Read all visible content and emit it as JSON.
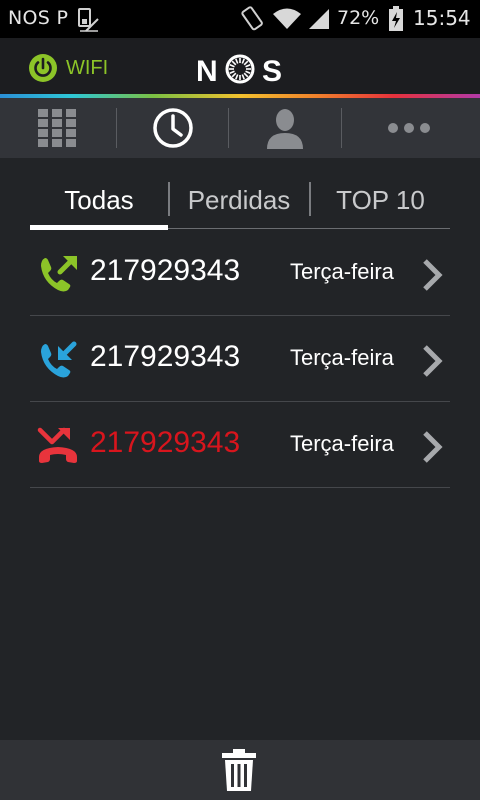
{
  "status_bar": {
    "carrier": "NOS P",
    "battery_percent": "72%",
    "time": "15:54"
  },
  "header": {
    "wifi_label": "WIFI",
    "wifi_color": "#8cc428",
    "logo_text": "NOS"
  },
  "nav": {
    "items": [
      {
        "icon": "dialpad-icon",
        "active": false
      },
      {
        "icon": "clock-icon",
        "active": true
      },
      {
        "icon": "contact-icon",
        "active": false
      },
      {
        "icon": "more-icon",
        "active": false
      }
    ]
  },
  "tabs": [
    {
      "label": "Todas",
      "active": true
    },
    {
      "label": "Perdidas",
      "active": false
    },
    {
      "label": "TOP 10",
      "active": false
    }
  ],
  "calls": [
    {
      "type": "outgoing",
      "icon": "outgoing-call-icon",
      "icon_color": "#8cc428",
      "number": "217929343",
      "day": "Terça-feira"
    },
    {
      "type": "incoming",
      "icon": "incoming-call-icon",
      "icon_color": "#2aa3db",
      "number": "217929343",
      "day": "Terça-feira"
    },
    {
      "type": "missed",
      "icon": "missed-call-icon",
      "icon_color": "#e8343c",
      "number": "217929343",
      "day": "Terça-feira"
    }
  ],
  "colors": {
    "missed_number": "#d8151d",
    "background": "#222427"
  },
  "bottom_bar": {
    "icon": "trash-icon"
  }
}
